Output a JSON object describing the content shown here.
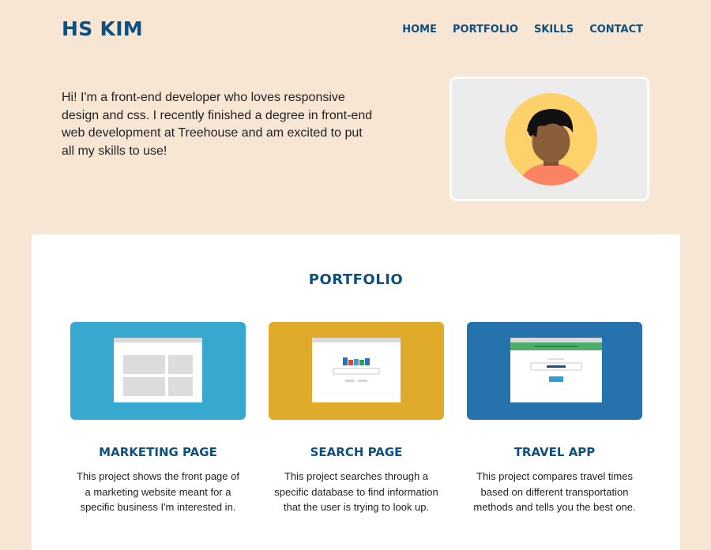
{
  "header": {
    "logo": "HS KIM",
    "nav": [
      "HOME",
      "PORTFOLIO",
      "SKILLS",
      "CONTACT"
    ]
  },
  "intro": {
    "text": "Hi! I'm a front-end developer who loves responsive design and css. I recently finished a degree in front-end web development at Treehouse and am excited to put all my skills to use!"
  },
  "portfolio": {
    "title": "PORTFOLIO",
    "projects": [
      {
        "title": "MARKETING PAGE",
        "description": "This project shows the front page of a marketing website meant for a specific business I'm interested in.",
        "color": "#37a9d1"
      },
      {
        "title": "SEARCH PAGE",
        "description": "This project searches through a specific database to find information that the user is trying to look up.",
        "color": "#e0aa2b"
      },
      {
        "title": "TRAVEL APP",
        "description": "This project compares travel times based on different transportation methods and tells you the best one.",
        "color": "#2672ad"
      }
    ]
  },
  "colors": {
    "background": "#f7e6d4",
    "accent": "#0f4f7e"
  }
}
